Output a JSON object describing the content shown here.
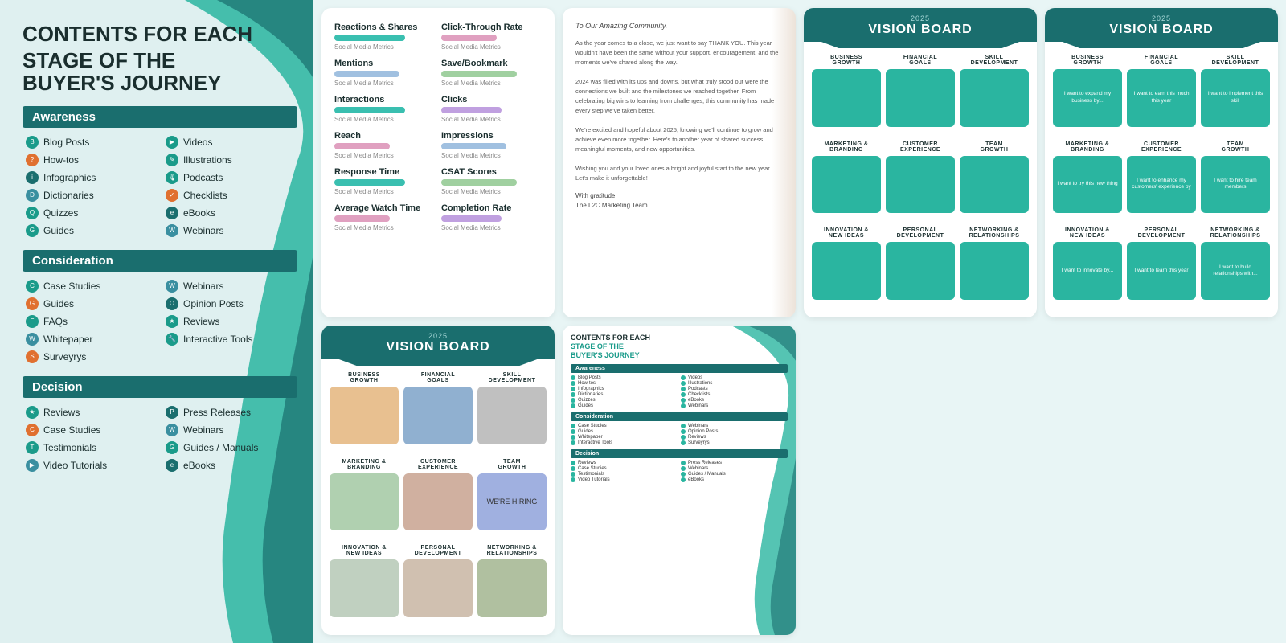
{
  "leftPanel": {
    "title_line1": "CONTENTS FOR EACH",
    "title_line2": "STAGE OF THE",
    "title_line3": "BUYER'S JOURNEY",
    "stages": [
      {
        "name": "Awareness",
        "items_col1": [
          "Blog Posts",
          "How-tos",
          "Infographics",
          "Dictionaries",
          "Quizzes",
          "Guides"
        ],
        "items_col2": [
          "Videos",
          "Illustrations",
          "Podcasts",
          "Checklists",
          "eBooks",
          "Webinars"
        ]
      },
      {
        "name": "Consideration",
        "items_col1": [
          "Case Studies",
          "Guides",
          "FAQs",
          "Whitepaper",
          "Interactive Tools",
          "Surveyrys"
        ],
        "items_col2": [
          "Webinars",
          "Opinion Posts",
          "Reviews"
        ]
      },
      {
        "name": "Decision",
        "items_col1": [
          "Reviews",
          "Case Studies",
          "Testimonials",
          "Guides / Manuals",
          "Video Tutorials",
          "eBooks"
        ],
        "items_col2": [
          "Press Releases",
          "Webinars"
        ]
      }
    ]
  },
  "metricsCard": {
    "metrics": [
      {
        "label": "Reactions & Shares",
        "sub": "Social Media Metrics"
      },
      {
        "label": "Click-Through Rate",
        "sub": "Social Media Metrics"
      },
      {
        "label": "Mentions",
        "sub": "Social Media Metrics"
      },
      {
        "label": "Save/Bookmark",
        "sub": "Social Media Metrics"
      },
      {
        "label": "Interactions",
        "sub": "Social Media Metrics"
      },
      {
        "label": "Clicks",
        "sub": "Social Media Metrics"
      },
      {
        "label": "Reach",
        "sub": "Social Media Metrics"
      },
      {
        "label": "Impressions",
        "sub": "Social Media Metrics"
      },
      {
        "label": "Response Time",
        "sub": "Social Media Metrics"
      },
      {
        "label": "CSAT Scores",
        "sub": "Social Media Metrics"
      },
      {
        "label": "Average Watch Time",
        "sub": "Social Media Metrics"
      },
      {
        "label": "Completion Rate",
        "sub": "Social Media Metrics"
      }
    ]
  },
  "letterCard": {
    "greeting": "To Our Amazing Community,",
    "body1": "As the year comes to a close, we just want to say THANK YOU. This year wouldn't have been the same without your support, encouragement, and the moments we've shared along the way.",
    "body2": "2024 was filled with its ups and downs, but what truly stood out were the connections we built and the milestones we reached together. From celebrating big wins to learning from challenges, this community has made every step we've taken better.",
    "body3": "We're excited and hopeful about 2025, knowing we'll continue to grow and achieve even more together. Here's to another year of shared success, meaningful moments, and new opportunities.",
    "body4": "Wishing you and your loved ones a bright and joyful start to the new year. Let's make it unforgettable!",
    "sig": "With gratitude,\nThe L2C Marketing Team"
  },
  "visionBoard1": {
    "year": "2025",
    "title": "VISION BOARD",
    "cells": [
      {
        "label": "BUSINESS\nGROWTH",
        "text": ""
      },
      {
        "label": "FINANCIAL\nGOALS",
        "text": ""
      },
      {
        "label": "SKILL\nDEVELOPMENT",
        "text": ""
      },
      {
        "label": "MARKETING &\nBRANDING",
        "text": ""
      },
      {
        "label": "CUSTOMER\nEXPERIENCE",
        "text": ""
      },
      {
        "label": "TEAM\nGROWTH",
        "text": ""
      },
      {
        "label": "INNOVATION &\nNEW IDEAS",
        "text": ""
      },
      {
        "label": "PERSONAL\nDEVELOPMENT",
        "text": ""
      },
      {
        "label": "NETWORKING &\nRELATIONSHIPS",
        "text": ""
      }
    ]
  },
  "visionBoard2": {
    "year": "2025",
    "title": "VISION BOARD",
    "cells": [
      {
        "label": "BUSINESS\nGROWTH",
        "text": "I want to expand my business by..."
      },
      {
        "label": "FINANCIAL\nGOALS",
        "text": "I want to earn this much this year"
      },
      {
        "label": "SKILL\nDEVELOPMENT",
        "text": "I want to implement this skill"
      },
      {
        "label": "MARKETING &\nBRANDING",
        "text": "I want to try this new thing"
      },
      {
        "label": "CUSTOMER\nEXPERIENCE",
        "text": "I want to enhance my customers' experience by"
      },
      {
        "label": "TEAM\nGROWTH",
        "text": "I want to hire team members"
      },
      {
        "label": "INNOVATION &\nNEW IDEAS",
        "text": "I want to innovate by..."
      },
      {
        "label": "PERSONAL\nDEVELOPMENT",
        "text": "I want to learn this year"
      },
      {
        "label": "NETWORKING &\nRELATIONSHIPS",
        "text": "I want to build relationships with..."
      }
    ]
  },
  "visionBoard3": {
    "year": "2025",
    "title": "VISION BOARD",
    "hasImages": true
  },
  "miniCard": {
    "title_line1": "CONTENTS FOR EACH",
    "title_line2": "STAGE OF THE",
    "title_line3": "BUYER'S JOURNEY"
  }
}
